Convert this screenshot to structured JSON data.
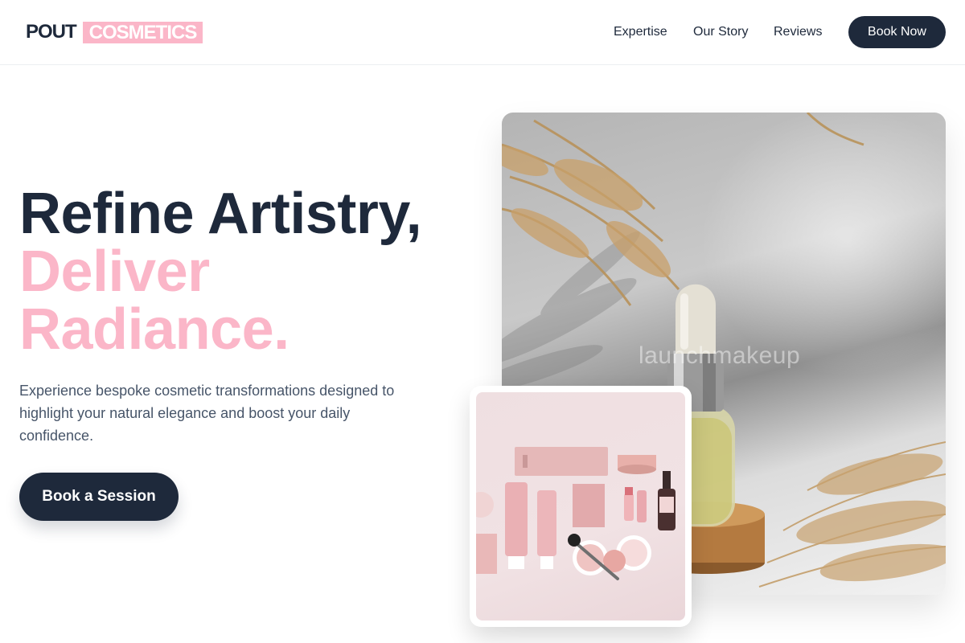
{
  "header": {
    "logo_main": "POUT",
    "logo_accent": "COSMETICS",
    "nav": [
      "Expertise",
      "Our Story",
      "Reviews"
    ],
    "book_now": "Book Now"
  },
  "hero": {
    "headline_line1": "Refine Artistry,",
    "headline_line2": "Deliver Radiance.",
    "description": "Experience bespoke cosmetic transformations designed to highlight your natural elegance and boost your daily confidence.",
    "cta": "Book a Session"
  },
  "images": {
    "main_watermark": "launchmakeup",
    "main_alt": "Serum dropper bottle on cork with dried grass",
    "card_alt": "Pink cosmetic product flatlay"
  },
  "colors": {
    "navy": "#1e293b",
    "pink": "#fbb6c8",
    "body_text": "#475569"
  }
}
